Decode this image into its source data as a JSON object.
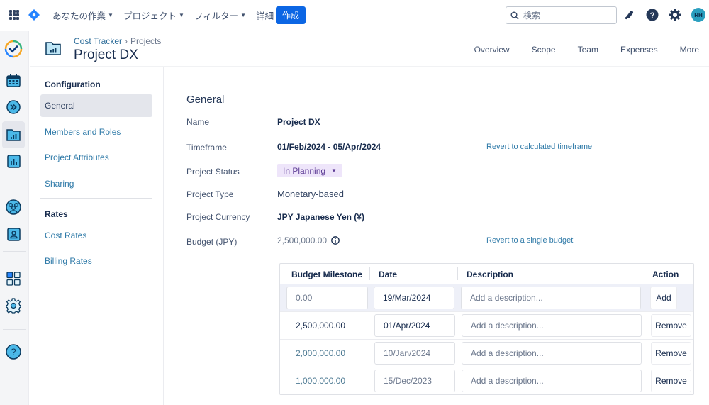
{
  "topbar": {
    "nav": [
      {
        "label": "あなたの作業"
      },
      {
        "label": "プロジェクト"
      },
      {
        "label": "フィルター"
      },
      {
        "label": "詳細"
      }
    ],
    "create_label": "作成",
    "search_placeholder": "検索",
    "avatar_initials": "RH",
    "accent_color": "#0c66e4"
  },
  "rail": {
    "icons": [
      "app-logo-icon",
      "calendar-icon",
      "forward-icon",
      "project-folder-icon",
      "reports-icon",
      "team-icon",
      "user-card-icon",
      "dashboard-grid-icon",
      "settings-icon",
      "help-icon"
    ],
    "active": "project-folder-icon"
  },
  "header": {
    "breadcrumb": [
      "Cost Tracker",
      "Projects"
    ],
    "breadcrumb_separator": "›",
    "title": "Project DX",
    "tabs": [
      "Overview",
      "Scope",
      "Team",
      "Expenses",
      "More"
    ]
  },
  "sidenav": {
    "configuration_heading": "Configuration",
    "configuration_items": [
      "General",
      "Members and Roles",
      "Project Attributes",
      "Sharing"
    ],
    "active_item": "General",
    "rates_heading": "Rates",
    "rates_items": [
      "Cost Rates",
      "Billing Rates"
    ]
  },
  "general": {
    "section_title": "General",
    "fields": {
      "name": {
        "label": "Name",
        "value": "Project DX"
      },
      "timeframe": {
        "label": "Timeframe",
        "value": "01/Feb/2024 - 05/Apr/2024",
        "link": "Revert to calculated timeframe"
      },
      "status": {
        "label": "Project Status",
        "value": "In Planning"
      },
      "type": {
        "label": "Project Type",
        "value": "Monetary-based"
      },
      "currency": {
        "label": "Project Currency",
        "value": "JPY Japanese Yen (¥)"
      },
      "budget": {
        "label": "Budget (JPY)",
        "value": "2,500,000.00",
        "link": "Revert to a single budget"
      }
    }
  },
  "milestones": {
    "headers": [
      "Budget Milestone",
      "Date",
      "Description",
      "Action"
    ],
    "new_row": {
      "amount_placeholder": "0.00",
      "date": "19/Mar/2024",
      "description_placeholder": "Add a description...",
      "action": "Add"
    },
    "rows": [
      {
        "amount": "2,500,000.00",
        "date": "01/Apr/2024",
        "description_placeholder": "Add a description...",
        "action": "Remove"
      },
      {
        "amount": "2,000,000.00",
        "date": "10/Jan/2024",
        "description_placeholder": "Add a description...",
        "action": "Remove"
      },
      {
        "amount": "1,000,000.00",
        "date": "15/Dec/2023",
        "description_placeholder": "Add a description...",
        "action": "Remove"
      }
    ]
  }
}
